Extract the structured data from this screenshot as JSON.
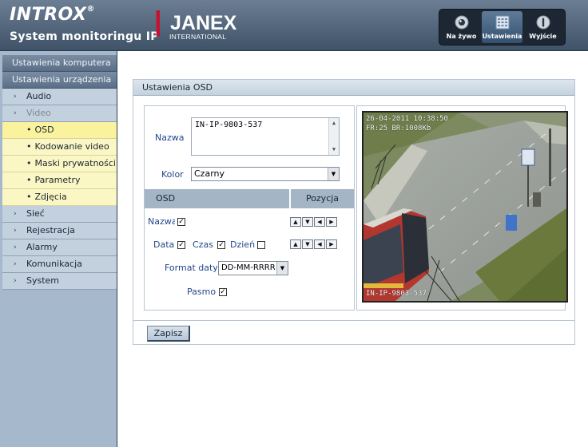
{
  "header": {
    "brand_main": "INTROX",
    "brand_reg": "®",
    "tagline": "System monitoringu IP",
    "partner_logo_text": "JANEX",
    "partner_logo_sub": "INTERNATIONAL",
    "nav": [
      {
        "label": "Na żywo",
        "icon": "camera-icon"
      },
      {
        "label": "Ustawienia",
        "icon": "settings-grid-icon"
      },
      {
        "label": "Wyjście",
        "icon": "exit-icon"
      }
    ],
    "active_nav": "Ustawienia"
  },
  "sidebar": {
    "sections": [
      "Ustawienia komputera",
      "Ustawienia urządzenia"
    ],
    "items": [
      {
        "label": "Audio"
      },
      {
        "label": "Video"
      },
      {
        "label": "Sieć"
      },
      {
        "label": "Rejestracja"
      },
      {
        "label": "Alarmy"
      },
      {
        "label": "Komunikacja"
      },
      {
        "label": "System"
      }
    ],
    "video_sub": [
      "OSD",
      "Kodowanie video",
      "Maski prywatności",
      "Parametry",
      "Zdjęcia"
    ]
  },
  "panel": {
    "title": "Ustawienia OSD",
    "name_label": "Nazwa",
    "name_value": "IN-IP-9803-537",
    "color_label": "Kolor",
    "color_value": "Czarny",
    "osd_col": "OSD",
    "pos_col": "Pozycja",
    "row_name_label": "Nazwa",
    "row_date_label": "Data",
    "row_time_label": "Czas",
    "row_day_label": "Dzień",
    "format_label": "Format daty",
    "format_value": "DD-MM-RRRR",
    "band_label": "Pasmo",
    "checks": {
      "name": true,
      "date": true,
      "time": true,
      "day": false,
      "band": true
    },
    "save_label": "Zapisz"
  },
  "preview": {
    "overlay_line1": "26-04-2011 10:38:50",
    "overlay_line2": "FR:25 BR:1008Kb",
    "overlay_bottom": "IN-IP-9803-537"
  }
}
